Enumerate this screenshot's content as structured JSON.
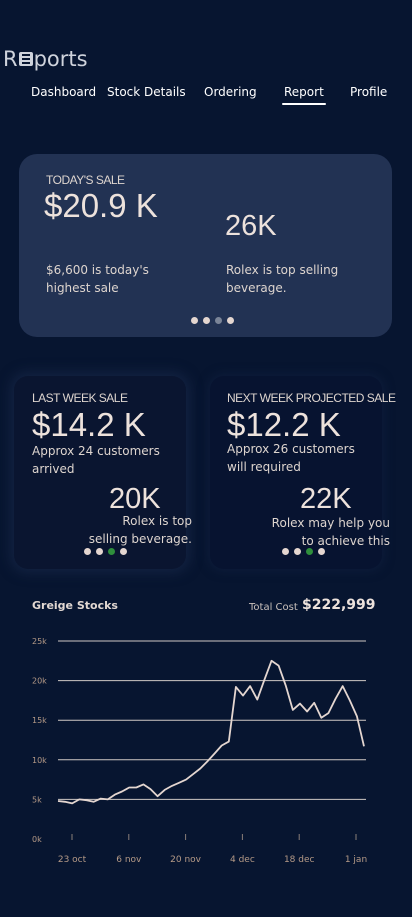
{
  "app": {
    "logo_r": "R",
    "logo_rest": "ports"
  },
  "nav": {
    "tabs": [
      {
        "label": "Dashboard"
      },
      {
        "label": "Stock Details"
      },
      {
        "label": "Ordering"
      },
      {
        "label": "Report",
        "active": true
      },
      {
        "label": "Profile"
      }
    ]
  },
  "today": {
    "label": "TODAY'S SALE",
    "value": "$20.9 K",
    "highest_text": "$6,600 is today's highest sale",
    "count": "26K",
    "top_text": "Rolex is top selling beverage."
  },
  "last_week": {
    "label": "LAST WEEK SALE",
    "value": "$14.2 K",
    "customers": "Approx 24 customers arrived",
    "count": "20K",
    "top_text": "Rolex is top selling beverage."
  },
  "next_week": {
    "label": "NEXT WEEK PROJECTED SALE",
    "value": "$12.2 K",
    "customers": "Approx 26 customers will required",
    "count": "22K",
    "top_text": "Rolex may help you to achieve this"
  },
  "colors": {
    "background": "#071530",
    "card": "#223253",
    "dot_active": "#2f8f3c",
    "line": "#e4d6d0"
  },
  "stocks": {
    "title": "Greige Stocks",
    "total_label": "Total Cost",
    "total_value": "$222,999"
  },
  "chart_data": {
    "type": "line",
    "title": "Greige Stocks",
    "xlabel": "",
    "ylabel": "",
    "ylim": [
      0,
      25000
    ],
    "y_ticks": [
      "0k",
      "5k",
      "10k",
      "15k",
      "20k",
      "25k"
    ],
    "x_ticks": [
      "23 oct",
      "6 nov",
      "20 nov",
      "4 dec",
      "18 dec",
      "1 jan"
    ],
    "grid": true,
    "series": [
      {
        "values": [
          4800,
          4700,
          4500,
          5000,
          4900,
          4700,
          5100,
          5000,
          5600,
          6000,
          6500,
          6500,
          6900,
          6300,
          5400,
          6200,
          6700,
          7100,
          7500,
          8200,
          8900,
          9800,
          10800,
          11800,
          12300,
          19200,
          18100,
          19300,
          17600,
          20100,
          22500,
          21900,
          19400,
          16300,
          17100,
          16100,
          17200,
          15300,
          15900,
          17700,
          19300,
          17500,
          15500,
          11700
        ]
      }
    ]
  }
}
